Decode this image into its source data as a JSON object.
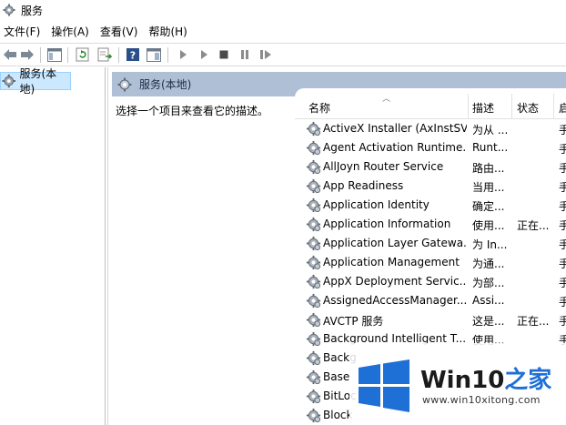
{
  "window": {
    "title": "服务"
  },
  "menu": [
    {
      "label": "文件(F)"
    },
    {
      "label": "操作(A)"
    },
    {
      "label": "查看(V)"
    },
    {
      "label": "帮助(H)"
    }
  ],
  "toolbar_icons": [
    "back-arrow-icon",
    "forward-arrow-icon",
    "console-tree-icon",
    "refresh-icon",
    "export-icon",
    "help-icon",
    "properties-icon",
    "start-icon",
    "start-alt-icon",
    "stop-icon",
    "pause-icon",
    "restart-icon"
  ],
  "tree": {
    "root_label": "服务(本地)"
  },
  "panel": {
    "header": "服务(本地)",
    "description": "选择一个项目来查看它的描述。"
  },
  "columns": {
    "name": "名称",
    "description": "描述",
    "status": "状态",
    "startup": "启"
  },
  "services": [
    {
      "name": "ActiveX Installer (AxInstSV)",
      "desc": "为从 ...",
      "status": "",
      "start": "手"
    },
    {
      "name": "Agent Activation Runtime...",
      "desc": "Runt...",
      "status": "",
      "start": "手"
    },
    {
      "name": "AllJoyn Router Service",
      "desc": "路由...",
      "status": "",
      "start": "手"
    },
    {
      "name": "App Readiness",
      "desc": "当用...",
      "status": "",
      "start": "手"
    },
    {
      "name": "Application Identity",
      "desc": "确定...",
      "status": "",
      "start": "手"
    },
    {
      "name": "Application Information",
      "desc": "使用...",
      "status": "正在...",
      "start": "手"
    },
    {
      "name": "Application Layer Gatewa...",
      "desc": "为 In...",
      "status": "",
      "start": "手"
    },
    {
      "name": "Application Management",
      "desc": "为通...",
      "status": "",
      "start": "手"
    },
    {
      "name": "AppX Deployment Servic...",
      "desc": "为部...",
      "status": "",
      "start": "手"
    },
    {
      "name": "AssignedAccessManager...",
      "desc": "Assi...",
      "status": "",
      "start": "手"
    },
    {
      "name": "AVCTP 服务",
      "desc": "这是...",
      "status": "正在...",
      "start": "手"
    },
    {
      "name": "Background Intelligent T...",
      "desc": "使用...",
      "status": "",
      "start": "手"
    },
    {
      "name": "Backg",
      "desc": "",
      "status": "",
      "start": ""
    },
    {
      "name": "Base",
      "desc": "",
      "status": "",
      "start": ""
    },
    {
      "name": "BitLoc",
      "desc": "",
      "status": "",
      "start": ""
    },
    {
      "name": "Block",
      "desc": "",
      "status": "",
      "start": ""
    }
  ],
  "watermark": {
    "title_prefix": "Win10",
    "title_suffix": "之家",
    "url": "www.win10xitong.com"
  },
  "colors": {
    "selection_bg": "#cce8ff",
    "header_bg": "#aebfd6",
    "win_logo": "#1e6fd6"
  }
}
